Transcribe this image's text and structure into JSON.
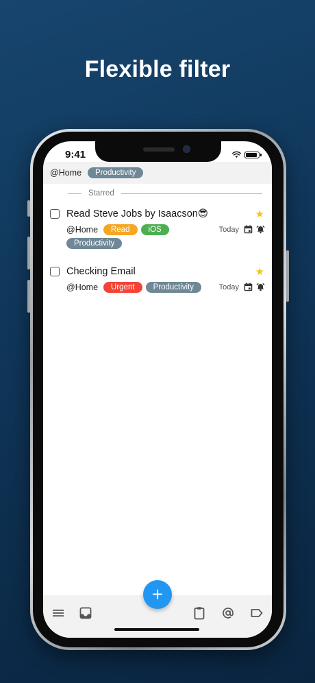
{
  "headline": "Flexible filter",
  "status_bar": {
    "time": "9:41"
  },
  "filter_bar": {
    "context": "@Home",
    "tag": "Productivity"
  },
  "section": {
    "label": "Starred"
  },
  "tasks": [
    {
      "title": "Read Steve Jobs by Isaacson😎",
      "context": "@Home",
      "tags": [
        {
          "label": "Read",
          "color": "#f5a623"
        },
        {
          "label": "iOS",
          "color": "#4caf50"
        },
        {
          "label": "Productivity",
          "color": "#6f8796"
        }
      ],
      "due": "Today",
      "starred": true
    },
    {
      "title": "Checking Email",
      "context": "@Home",
      "tags": [
        {
          "label": "Urgent",
          "color": "#f44336"
        },
        {
          "label": "Productivity",
          "color": "#6f8796"
        }
      ],
      "due": "Today",
      "starred": true
    }
  ],
  "fab": {
    "label": "+"
  },
  "colors": {
    "accent": "#2196f3",
    "tag_gray": "#6f8796",
    "star": "#f5c518",
    "background_top": "#17456e",
    "background_bottom": "#0a2540"
  },
  "icons": {
    "bottom_nav": [
      "menu-icon",
      "inbox-icon",
      "clipboard-icon",
      "at-context-icon",
      "label-tag-icon"
    ],
    "task_meta": [
      "calendar-icon",
      "alarm-icon",
      "star-icon"
    ]
  }
}
